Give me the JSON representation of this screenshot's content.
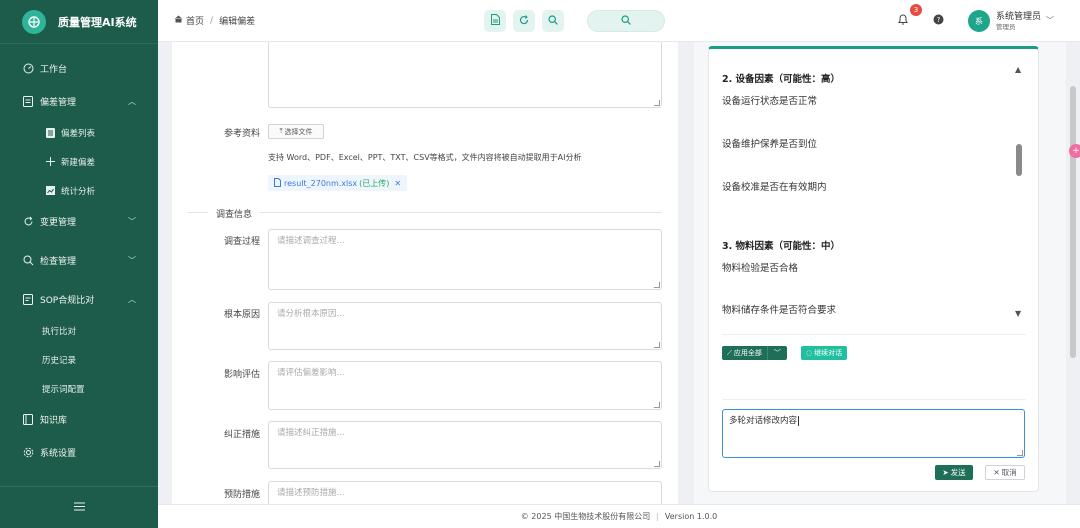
{
  "app": {
    "title": "质量管理AI系统"
  },
  "sidebar": {
    "items": [
      {
        "label": "工作台",
        "icon": "dashboard-icon"
      },
      {
        "label": "偏差管理",
        "icon": "document-icon"
      },
      {
        "label": "偏差列表",
        "icon": "list-icon"
      },
      {
        "label": "新建偏差",
        "icon": "plus-icon"
      },
      {
        "label": "统计分析",
        "icon": "chart-icon"
      },
      {
        "label": "变更管理",
        "icon": "refresh-icon"
      },
      {
        "label": "检查管理",
        "icon": "search-icon"
      },
      {
        "label": "SOP合规比对",
        "icon": "compare-icon"
      },
      {
        "label": "执行比对"
      },
      {
        "label": "历史记录"
      },
      {
        "label": "提示词配置"
      },
      {
        "label": "知识库",
        "icon": "book-icon"
      },
      {
        "label": "系统设置",
        "icon": "gear-icon"
      }
    ]
  },
  "header": {
    "breadcrumb": {
      "home": "首页",
      "sep": "/",
      "current": "编辑偏差"
    },
    "notification_count": "3",
    "user": {
      "avatar": "系",
      "name": "系统管理员",
      "role": "管理员"
    }
  },
  "form": {
    "attachment_label": "参考资料",
    "upload_button": "选择文件",
    "upload_hint": "支持 Word、PDF、Excel、PPT、TXT、CSV等格式，文件内容将被自动提取用于AI分析",
    "file": {
      "name": "result_270nm.xlsx",
      "status": "(已上传)"
    },
    "section_label": "调查信息",
    "fields": [
      {
        "label": "调查过程",
        "placeholder": "请描述调查过程..."
      },
      {
        "label": "根本原因",
        "placeholder": "请分析根本原因..."
      },
      {
        "label": "影响评估",
        "placeholder": "请评估偏差影响..."
      },
      {
        "label": "纠正措施",
        "placeholder": "请描述纠正措施..."
      },
      {
        "label": "预防措施",
        "placeholder": "请描述预防措施..."
      }
    ]
  },
  "ai_panel": {
    "sections": [
      {
        "title": "2. 设备因素（可能性：高）",
        "items": [
          "设备运行状态是否正常",
          "设备维护保养是否到位",
          "设备校准是否在有效期内"
        ]
      },
      {
        "title": "3. 物料因素（可能性：中）",
        "items": [
          "物料检验是否合格",
          "物料储存条件是否符合要求"
        ]
      }
    ],
    "apply_all": "应用全部",
    "continue_chat": "继续对话",
    "chat_input": "多轮对话修改内容",
    "send": "发送",
    "cancel": "取消"
  },
  "footer": {
    "copyright": "© 2025 中国生物技术股份有限公司",
    "version": "Version 1.0.0"
  }
}
